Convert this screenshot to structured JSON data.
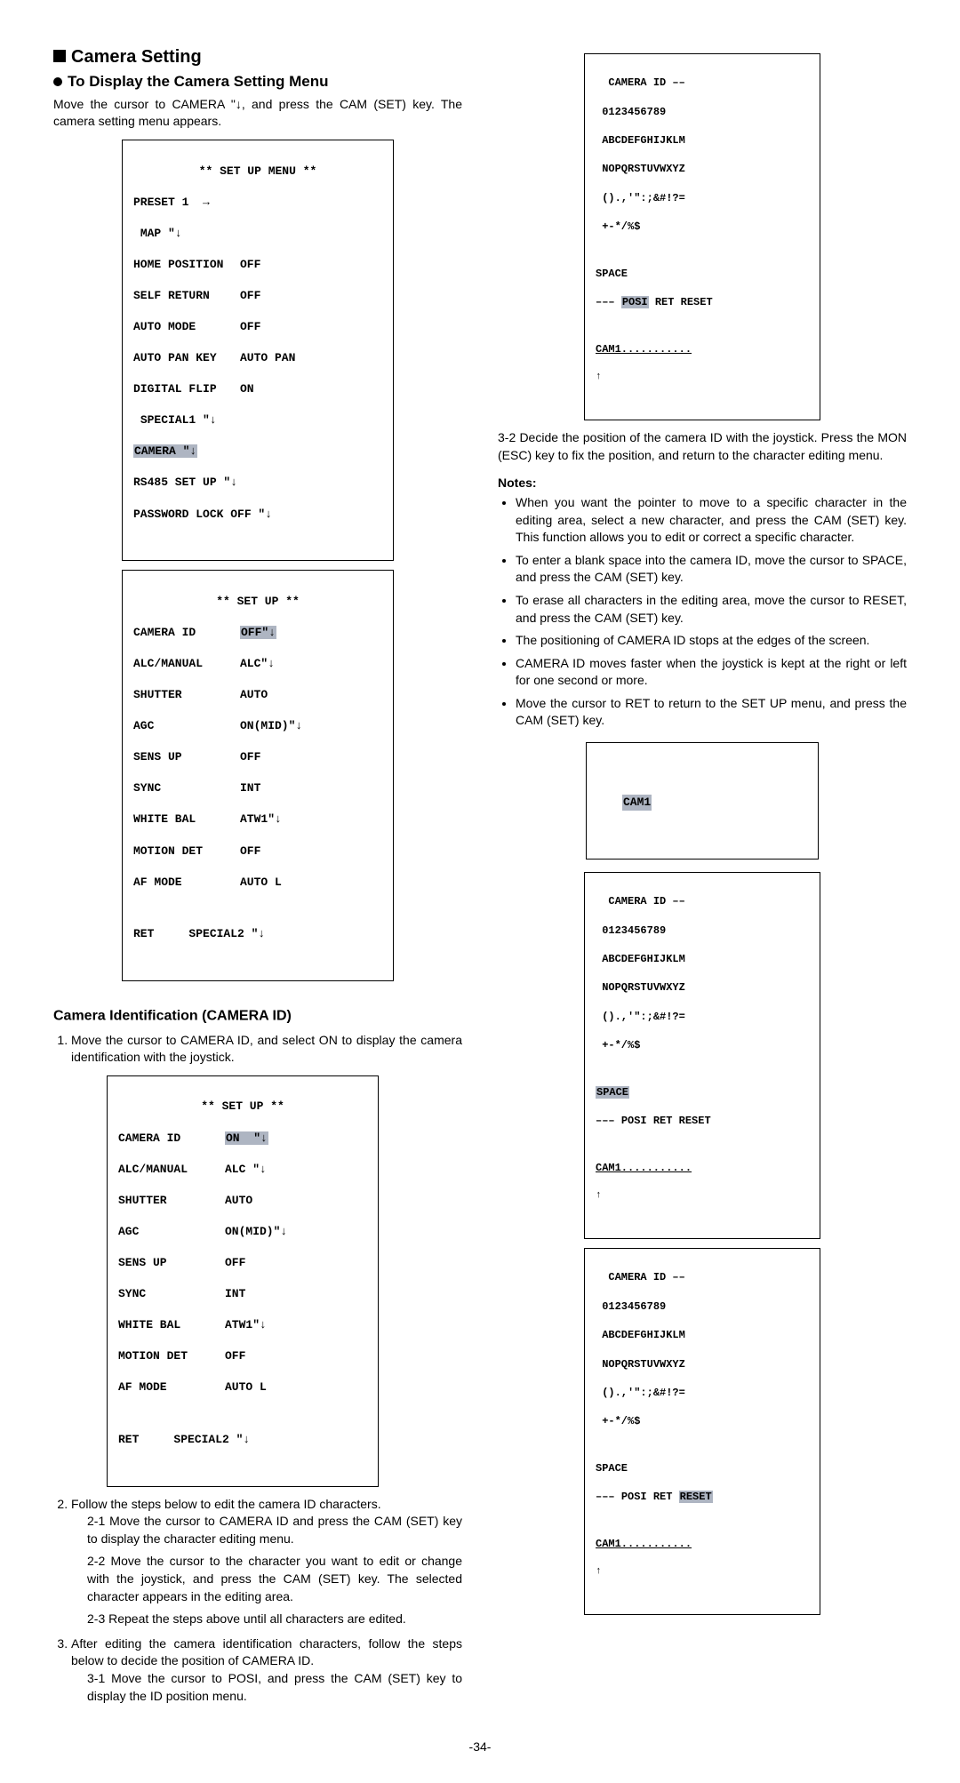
{
  "left": {
    "title": "Camera Setting",
    "subtitle": "To Display the Camera Setting Menu",
    "intro": "Move the cursor to CAMERA \"↓, and press the CAM (SET) key. The camera setting menu appears.",
    "menu1": {
      "title": "** SET UP MENU **",
      "preset": "PRESET 1  →",
      "map": "MAP \"↓",
      "rows": [
        {
          "k": "HOME POSITION",
          "v": "OFF"
        },
        {
          "k": "SELF RETURN",
          "v": "OFF"
        },
        {
          "k": "AUTO MODE",
          "v": "OFF"
        },
        {
          "k": "AUTO PAN KEY",
          "v": "AUTO PAN"
        },
        {
          "k": "DIGITAL FLIP",
          "v": "ON"
        }
      ],
      "special": "SPECIAL1 \"↓",
      "camera": "CAMERA \"↓",
      "rs485": "RS485 SET UP \"↓",
      "pwd": "PASSWORD LOCK OFF \"↓"
    },
    "menu2": {
      "title": "** SET UP **",
      "rows": [
        {
          "k": "CAMERA ID",
          "v": "OFF\"↓",
          "hl": true
        },
        {
          "k": "ALC/MANUAL",
          "v": "ALC\"↓"
        },
        {
          "k": "SHUTTER",
          "v": "AUTO"
        },
        {
          "k": "AGC",
          "v": "ON(MID)\"↓"
        },
        {
          "k": "SENS UP",
          "v": "OFF"
        },
        {
          "k": "SYNC",
          "v": "INT"
        },
        {
          "k": "WHITE BAL",
          "v": "ATW1\"↓"
        },
        {
          "k": "MOTION DET",
          "v": "OFF"
        },
        {
          "k": "AF MODE",
          "v": "AUTO L"
        }
      ],
      "footer": "RET     SPECIAL2 \"↓"
    },
    "camid_title": "Camera Identification (CAMERA ID)",
    "step1": "Move the cursor to CAMERA ID, and select ON to display the camera identification with the joystick.",
    "menu3": {
      "title": "** SET UP **",
      "rows": [
        {
          "k": "CAMERA ID",
          "v": "ON  \"↓",
          "hl": true
        },
        {
          "k": "ALC/MANUAL",
          "v": "ALC \"↓"
        },
        {
          "k": "SHUTTER",
          "v": "AUTO"
        },
        {
          "k": "AGC",
          "v": "ON(MID)\"↓"
        },
        {
          "k": "SENS UP",
          "v": "OFF"
        },
        {
          "k": "SYNC",
          "v": "INT"
        },
        {
          "k": "WHITE BAL",
          "v": "ATW1\"↓"
        },
        {
          "k": "MOTION DET",
          "v": "OFF"
        },
        {
          "k": "AF MODE",
          "v": "AUTO L"
        }
      ],
      "footer": "RET     SPECIAL2 \"↓"
    },
    "step2": "Follow the steps below to edit the camera ID characters.",
    "step2_1": "Move the cursor to CAMERA ID and press the CAM (SET) key to display the character editing menu.",
    "step2_2": "Move the cursor to the character you want to edit or change with the joystick, and press the CAM (SET) key. The selected character appears in the editing area.",
    "step2_3": "Repeat the steps above until all characters are edited.",
    "step3": "After editing the camera identification characters, follow the steps below to decide the position of CAMERA ID.",
    "step3_1": "Move the cursor to POSI, and press the CAM (SET) key to display the ID position menu."
  },
  "right": {
    "chareditA": {
      "title": "CAMERA ID ––",
      "line1": "0123456789",
      "line2": "ABCDEFGHIJKLM",
      "line3": "NOPQRSTUVWXYZ",
      "line4": "().,'\":;&#!?=",
      "line5": "+-*/%$",
      "space": "SPACE",
      "controls_pre": "––– ",
      "posi": "POSI",
      "ret": "RET",
      "reset": "RESET",
      "edit": "CAM1...........",
      "hl": "POSI"
    },
    "step3_2": "Decide the position of the camera ID with the joystick. Press the MON (ESC) key to fix the position, and return to the character editing menu.",
    "notes_title": "Notes:",
    "notes": [
      "When you want the pointer to move to a specific character in the editing area, select a new character, and press the CAM (SET) key. This function allows you to edit or correct a specific character.",
      "To enter a blank space into the camera ID, move the cursor to SPACE, and press the CAM (SET) key.",
      "To erase all characters in the editing area, move the cursor to RESET, and press the CAM (SET) key.",
      "The positioning of CAMERA ID stops at the edges of the screen.",
      "CAMERA ID moves faster when the joystick is kept at the right or left for one second or more.",
      "Move the cursor to RET to return to the SET UP menu, and press the CAM (SET) key."
    ],
    "preview_label": "CAM1",
    "chareditB_hl": "SPACE",
    "chareditC_hl": "RESET"
  },
  "pagenum": "-34-"
}
